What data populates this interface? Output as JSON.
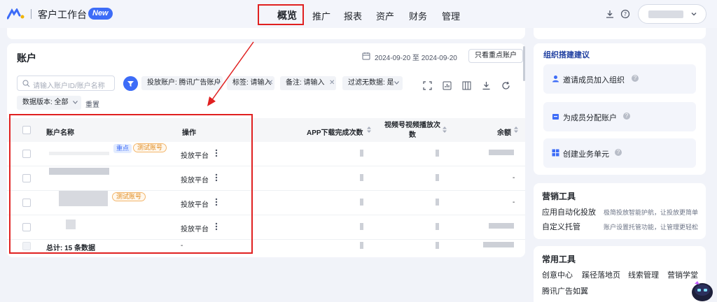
{
  "header": {
    "app_title": "客户工作台",
    "new_badge": "New",
    "nav": [
      {
        "label": "概览",
        "active": true
      },
      {
        "label": "推广"
      },
      {
        "label": "报表"
      },
      {
        "label": "资产"
      },
      {
        "label": "财务"
      },
      {
        "label": "管理"
      }
    ],
    "icons": [
      "download-icon",
      "help-icon",
      "chevron-down-icon"
    ]
  },
  "accounts": {
    "title": "账户",
    "date_range": "2024-09-20 至 2024-09-20",
    "key_only_button": "只看重点账户",
    "search_placeholder": "请输入账户ID/账户名称",
    "chips": [
      {
        "label": "投放账户: 腾讯广告账户",
        "kind": "dropdown"
      },
      {
        "label": "标签: 请输入",
        "kind": "close"
      },
      {
        "label": "备注: 请输入",
        "kind": "close"
      },
      {
        "label": "过滤无数据: 是",
        "kind": "dropdown"
      },
      {
        "label": "数据版本: 全部",
        "kind": "dropdown"
      }
    ],
    "reset": "重置",
    "toolbar_icons": [
      "fullscreen-icon",
      "chart-icon",
      "columns-icon",
      "download-icon",
      "refresh-icon"
    ],
    "columns": [
      "账户名称",
      "操作",
      "APP下载完成次数",
      "视频号视频播放次数",
      "余额"
    ],
    "rows": [
      {
        "tags": [
          "重点",
          "测试账号"
        ],
        "action": "投放平台"
      },
      {
        "tags": [],
        "action": "投放平台"
      },
      {
        "tags": [
          "测试账号"
        ],
        "action": "投放平台"
      },
      {
        "tags": [],
        "action": "投放平台"
      }
    ],
    "footer_total": "总计: 15 条数据",
    "footer_action": "-"
  },
  "right_panel": {
    "org": {
      "title": "组织搭建建议",
      "items": [
        {
          "label": "邀请成员加入组织",
          "icon": "user-icon"
        },
        {
          "label": "为成员分配账户",
          "icon": "account-icon"
        },
        {
          "label": "创建业务单元",
          "icon": "grid-icon"
        }
      ]
    },
    "marketing": {
      "title": "营销工具",
      "items": [
        {
          "label": "应用自动化投放",
          "desc": "极简投放智能护航，让投放更简单"
        },
        {
          "label": "自定义托管",
          "desc": "账户设置托管功能，让管理更轻松"
        }
      ]
    },
    "common": {
      "title": "常用工具",
      "row1": [
        "创意中心",
        "蹊径落地页",
        "线索管理",
        "营销学堂"
      ],
      "row2": [
        "腾讯广告如翼"
      ]
    }
  },
  "colors": {
    "accent": "#3d6cf7",
    "highlight": "#e02020",
    "orange": "#e08a1e"
  }
}
